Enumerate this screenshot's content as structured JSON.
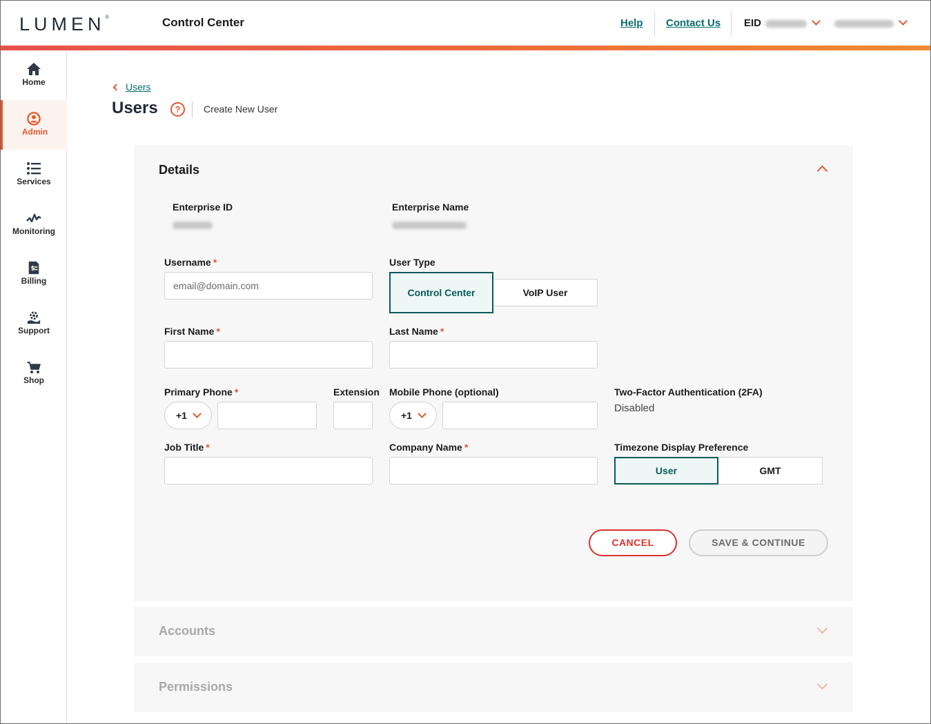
{
  "header": {
    "logo": "LUMEN",
    "app_title": "Control Center",
    "help_link": "Help",
    "contact_link": "Contact Us",
    "eid_label": "EID"
  },
  "sidebar": {
    "items": [
      {
        "label": "Home",
        "icon": "home-icon"
      },
      {
        "label": "Admin",
        "icon": "user-icon",
        "active": true
      },
      {
        "label": "Services",
        "icon": "list-icon"
      },
      {
        "label": "Monitoring",
        "icon": "pulse-icon"
      },
      {
        "label": "Billing",
        "icon": "invoice-icon"
      },
      {
        "label": "Support",
        "icon": "support-icon"
      },
      {
        "label": "Shop",
        "icon": "cart-icon"
      }
    ]
  },
  "breadcrumb": {
    "link": "Users"
  },
  "page": {
    "title": "Users",
    "help_glyph": "?",
    "subtitle": "Create New User"
  },
  "details": {
    "title": "Details",
    "enterprise_id_label": "Enterprise ID",
    "enterprise_name_label": "Enterprise Name",
    "username_label": "Username",
    "username_placeholder": "email@domain.com",
    "required_mark": "*",
    "user_type_label": "User Type",
    "user_type_options": [
      "Control Center",
      "VoIP User"
    ],
    "first_name_label": "First Name",
    "last_name_label": "Last Name",
    "primary_phone_label": "Primary Phone",
    "extension_label": "Extension",
    "mobile_phone_label": "Mobile Phone (optional)",
    "country_code": "+1",
    "twofa_label": "Two-Factor Authentication (2FA)",
    "twofa_value": "Disabled",
    "job_title_label": "Job Title",
    "company_name_label": "Company Name",
    "timezone_label": "Timezone Display Preference",
    "timezone_options": [
      "User",
      "GMT"
    ],
    "cancel_button": "CANCEL",
    "save_button": "SAVE & CONTINUE"
  },
  "accounts": {
    "title": "Accounts"
  },
  "permissions": {
    "title": "Permissions"
  },
  "colors": {
    "accent": "#e4572e",
    "teal": "#0a5959",
    "link": "#0a6b6b",
    "cancel": "#d9322b"
  }
}
